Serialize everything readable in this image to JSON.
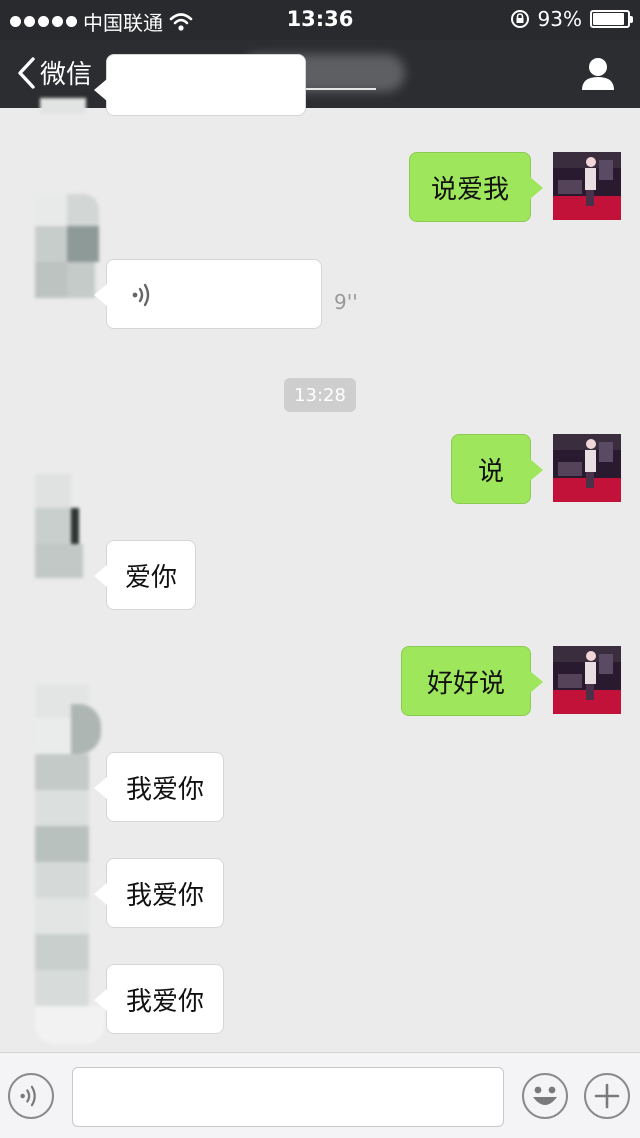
{
  "status_bar": {
    "carrier": "中国联通",
    "time": "13:36",
    "battery_text": "93%",
    "battery_level": 0.93
  },
  "nav": {
    "back_label": "微信"
  },
  "messages": {
    "m1": "说爱我",
    "voice_duration": "9''",
    "timestamp": "13:28",
    "m2": "说",
    "m3": "爱你",
    "m4": "好好说",
    "m5": "我爱你",
    "m6": "我爱你",
    "m7": "我爱你"
  },
  "input": {
    "value": "",
    "placeholder": ""
  },
  "colors": {
    "sent_bubble": "#9ee65b",
    "received_bubble": "#ffffff",
    "nav_background": "#2b2d30"
  }
}
